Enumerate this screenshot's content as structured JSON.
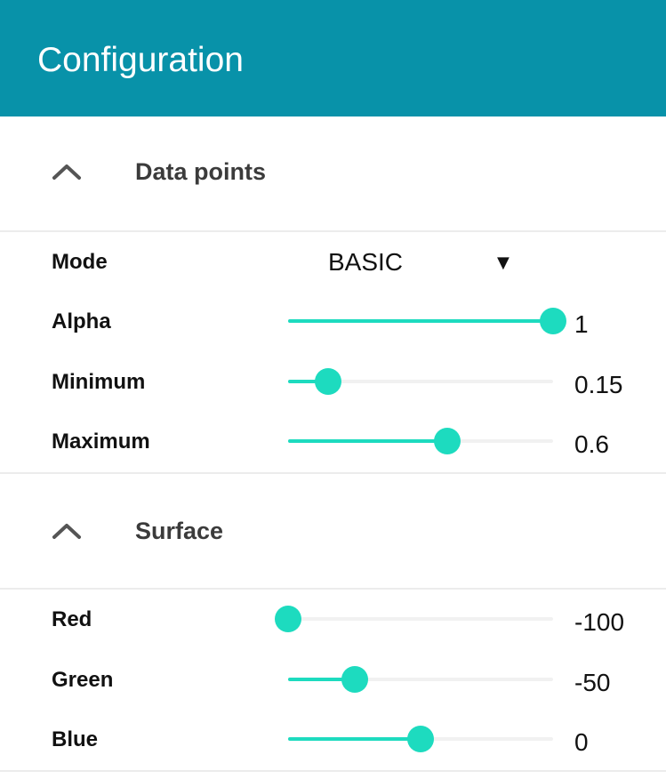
{
  "header": {
    "title": "Configuration"
  },
  "sections": {
    "data_points": {
      "title": "Data points",
      "icon": "chevron-up-icon",
      "mode": {
        "label": "Mode",
        "value": "BASIC",
        "arrow": "▼"
      },
      "alpha": {
        "label": "Alpha",
        "value": "1",
        "min": 0,
        "max": 1,
        "fraction": 1
      },
      "minimum": {
        "label": "Minimum",
        "value": "0.15",
        "min": 0,
        "max": 1,
        "fraction": 0.15
      },
      "maximum": {
        "label": "Maximum",
        "value": "0.6",
        "min": 0,
        "max": 1,
        "fraction": 0.6
      }
    },
    "surface": {
      "title": "Surface",
      "icon": "chevron-up-icon",
      "red": {
        "label": "Red",
        "value": "-100",
        "min": -100,
        "max": 100,
        "fraction": 0
      },
      "green": {
        "label": "Green",
        "value": "-50",
        "min": -100,
        "max": 100,
        "fraction": 0.25
      },
      "blue": {
        "label": "Blue",
        "value": "0",
        "min": -100,
        "max": 100,
        "fraction": 0.5
      }
    }
  },
  "colors": {
    "header_bg": "#0892a9",
    "accent": "#1ddbbf",
    "track": "#f1f1f1",
    "divider": "#ececec"
  }
}
